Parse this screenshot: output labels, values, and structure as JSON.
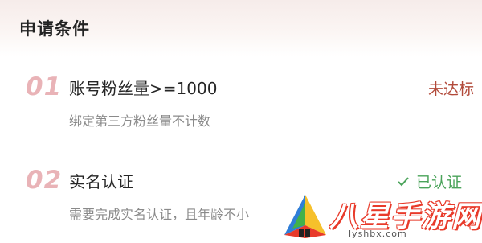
{
  "header": {
    "title": "申请条件"
  },
  "conditions": [
    {
      "number": "01",
      "title": "账号粉丝量>=1000",
      "description": "绑定第三方粉丝量不计数",
      "status": "未达标",
      "status_color": "#b24a3a"
    },
    {
      "number": "02",
      "title": "实名认证",
      "description": "需要完成实名认证，且年龄不小",
      "status": "已认证",
      "status_icon": "check-icon",
      "status_color": "#4aa35a"
    }
  ],
  "watermark": {
    "text": "八星手游网",
    "url": "lyshbx.com"
  },
  "colors": {
    "number_pink": "#e9b3b7",
    "header_bg": "#f6ecea",
    "watermark_red": "#e83a2a"
  }
}
